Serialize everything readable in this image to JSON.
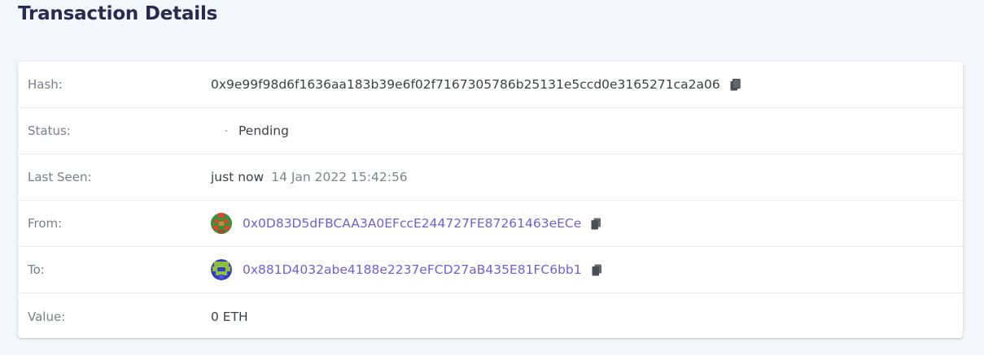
{
  "page": {
    "title": "Transaction Details"
  },
  "details": {
    "hash": {
      "label": "Hash:",
      "value": "0x9e99f98d6f1636aa183b39e6f02f7167305786b25131e5ccd0e3165271ca2a06"
    },
    "status": {
      "label": "Status:",
      "value": "Pending"
    },
    "last_seen": {
      "label": "Last Seen:",
      "relative": "just now",
      "timestamp": "14 Jan 2022 15:42:56"
    },
    "from": {
      "label": "From:",
      "address": "0x0D83D5dFBCAA3A0EFccE244727FE87261463eECe"
    },
    "to": {
      "label": "To:",
      "address": "0x881D4032abe4188e2237eFCD27aB435E81FC6bb1"
    },
    "value": {
      "label": "Value:",
      "amount": "0 ETH"
    }
  },
  "colors": {
    "background": "#f3f6fa",
    "title": "#262b4f",
    "link": "#7260d0",
    "label": "#7a7f88"
  },
  "icons": {
    "copy": "copy-icon",
    "from_avatar": "identicon-avatar",
    "to_avatar": "identicon-avatar"
  }
}
